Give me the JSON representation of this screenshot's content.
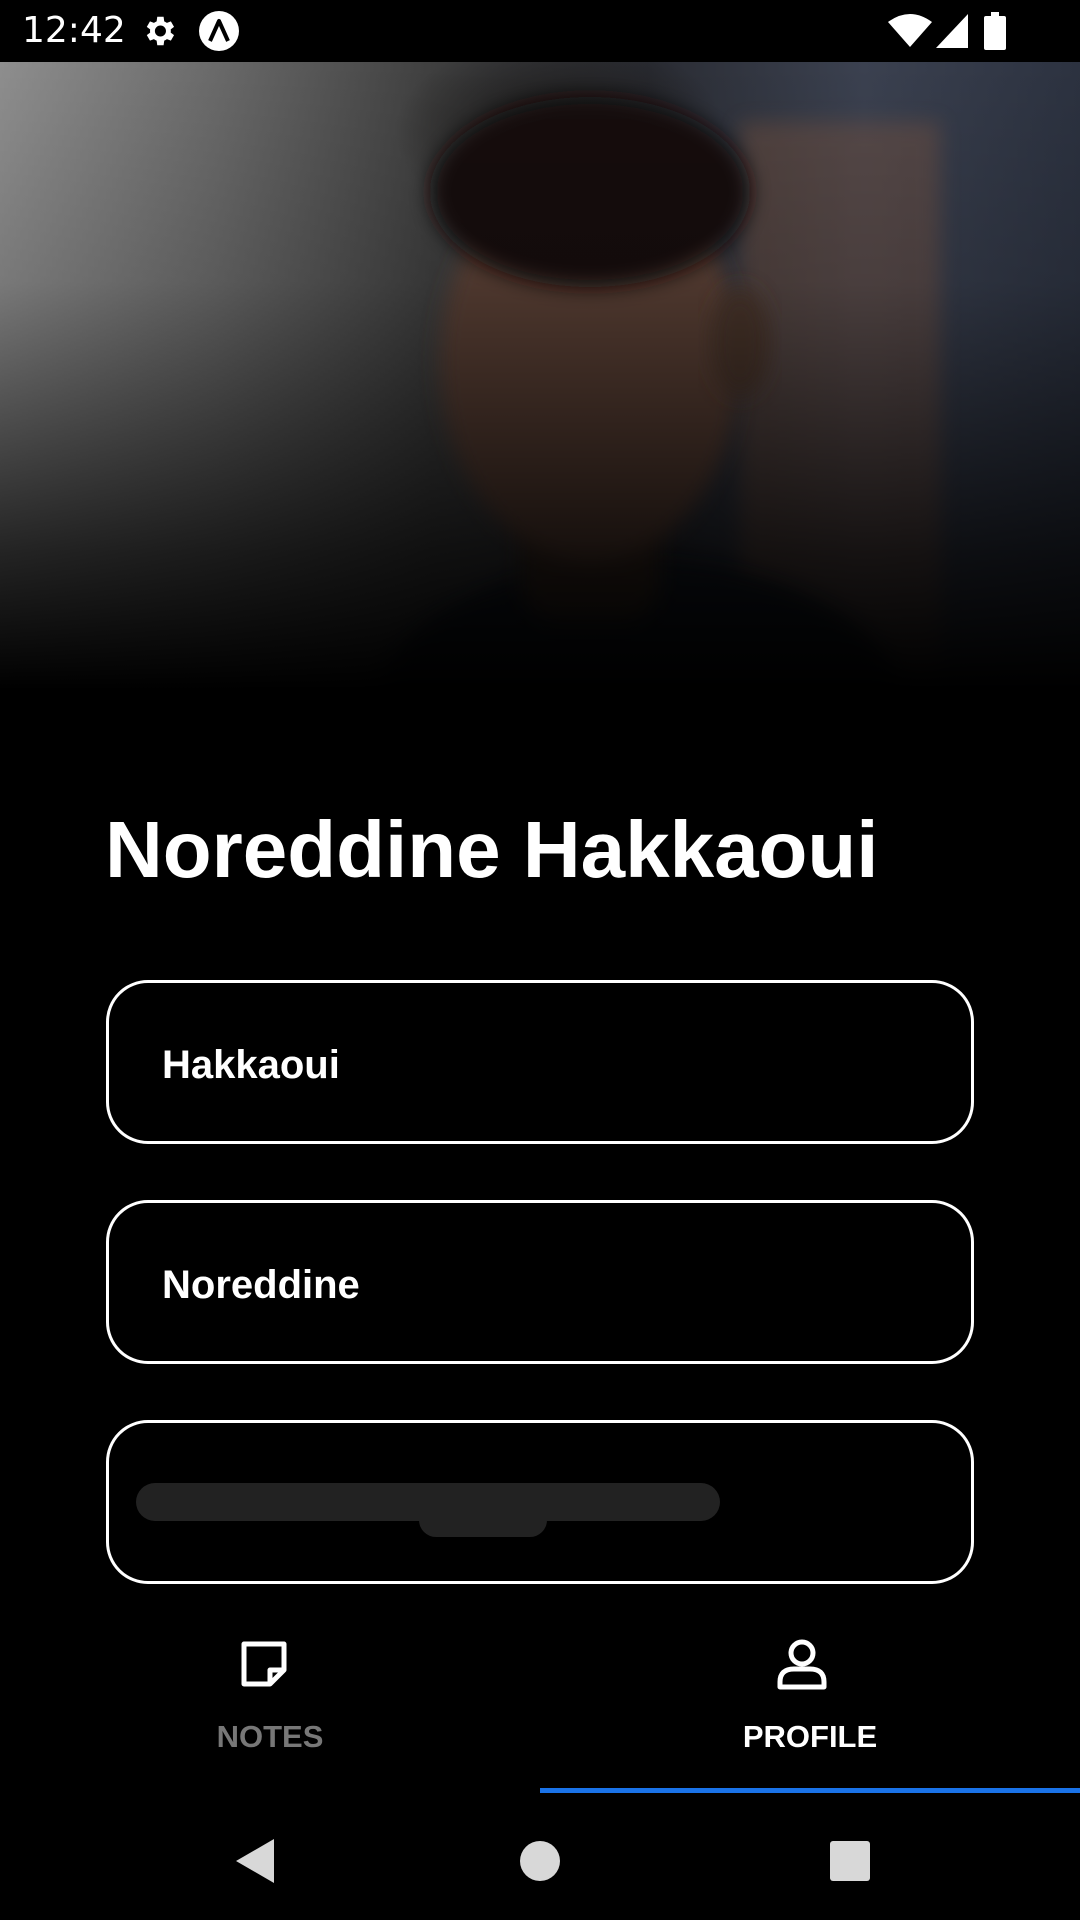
{
  "status_bar": {
    "time": "12:42",
    "icons": [
      "gear-icon",
      "app-notification-icon",
      "wifi-icon",
      "cellular-signal-icon",
      "battery-icon"
    ]
  },
  "hero": {
    "image": "profile-photo"
  },
  "profile": {
    "full_name": "Noreddine Hakkaoui",
    "fields": [
      {
        "value": "Hakkaoui"
      },
      {
        "value": "Noreddine"
      },
      {
        "value": ""
      }
    ]
  },
  "tabs": [
    {
      "label": "NOTES",
      "icon": "note-icon",
      "active": false,
      "color": "#777777"
    },
    {
      "label": "PROFILE",
      "icon": "person-icon",
      "active": true,
      "color": "#ffffff"
    }
  ],
  "colors": {
    "accent": "#1a73e8",
    "background": "#000000",
    "inactive_tab": "#777777"
  },
  "nav_bar": {
    "buttons": [
      "back-icon",
      "home-icon",
      "recents-icon"
    ]
  }
}
